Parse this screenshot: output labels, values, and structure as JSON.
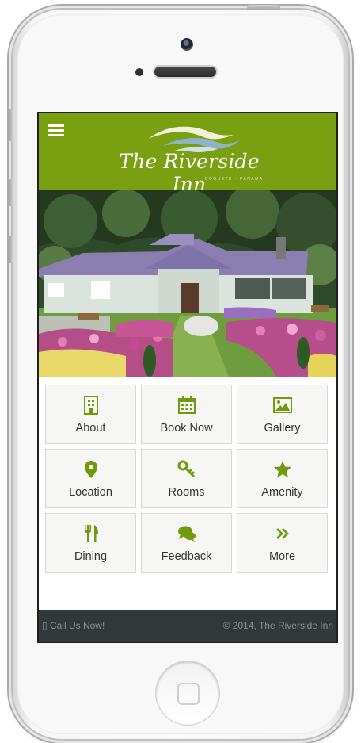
{
  "app": {
    "name": "The Riverside Inn",
    "subtitle": "BOQUETE · PANAMA"
  },
  "colors": {
    "brand_green": "#7a9f10",
    "footer_bg": "#32383a",
    "tile_bg": "#f6f7f5",
    "icon_green": "#6f9a0e"
  },
  "tiles": [
    {
      "label": "About",
      "icon": "building-icon"
    },
    {
      "label": "Book Now",
      "icon": "calendar-icon"
    },
    {
      "label": "Gallery",
      "icon": "image-icon"
    },
    {
      "label": "Location",
      "icon": "map-marker-icon"
    },
    {
      "label": "Rooms",
      "icon": "key-icon"
    },
    {
      "label": "Amenity",
      "icon": "star-icon"
    },
    {
      "label": "Dining",
      "icon": "cutlery-icon"
    },
    {
      "label": "Feedback",
      "icon": "chat-bubbles-icon"
    },
    {
      "label": "More",
      "icon": "double-chevron-right-icon"
    }
  ],
  "footer": {
    "call_label": "Call Us Now!",
    "copyright": "© 2014, The Riverside Inn"
  }
}
